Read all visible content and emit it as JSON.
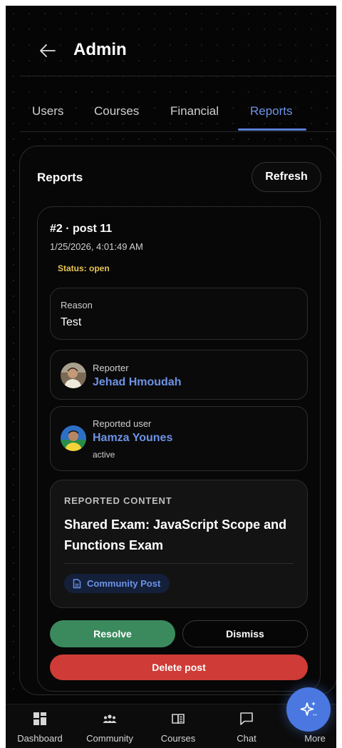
{
  "header": {
    "title": "Admin"
  },
  "tabs": [
    {
      "label": "Users"
    },
    {
      "label": "Courses"
    },
    {
      "label": "Financial"
    },
    {
      "label": "Reports",
      "active": true
    }
  ],
  "reports": {
    "title": "Reports",
    "refresh_label": "Refresh",
    "item": {
      "id_line": "#2 · post 11",
      "date": "1/25/2026, 4:01:49 AM",
      "status": "Status: open",
      "reason_label": "Reason",
      "reason_value": "Test",
      "reporter_label": "Reporter",
      "reporter_name": "Jehad Hmoudah",
      "reported_label": "Reported user",
      "reported_name": "Hamza Younes",
      "reported_status": "active",
      "content_label": "REPORTED CONTENT",
      "content_title": "Shared Exam: JavaScript Scope and Functions Exam",
      "content_chip": "Community Post",
      "resolve_label": "Resolve",
      "dismiss_label": "Dismiss",
      "delete_label": "Delete post"
    }
  },
  "bottom_nav": [
    {
      "label": "Dashboard",
      "icon": "dashboard-icon"
    },
    {
      "label": "Community",
      "icon": "community-icon"
    },
    {
      "label": "Courses",
      "icon": "book-icon"
    },
    {
      "label": "Chat",
      "icon": "chat-icon"
    },
    {
      "label": "More",
      "icon": "sparkle-icon"
    }
  ],
  "colors": {
    "accent": "#6d93e6",
    "status": "#e8c454",
    "resolve": "#3a8a5e",
    "delete": "#cf3b36",
    "fab": "#4a78e0"
  }
}
